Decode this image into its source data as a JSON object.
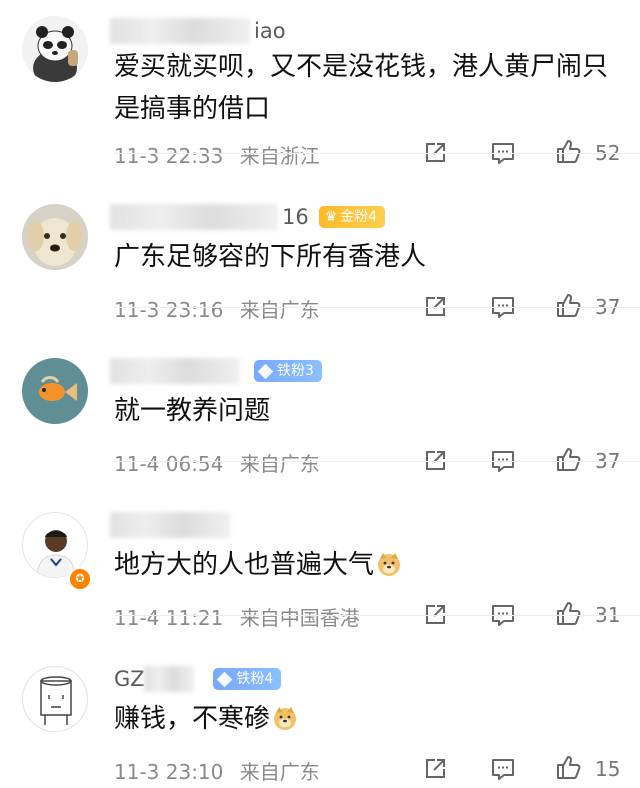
{
  "comments": [
    {
      "name_visible": "iao",
      "badge": null,
      "text": "爱买就买呗，又不是没花钱，港人黄尸闹只是搞事的借口",
      "time": "11-3 22:33",
      "location": "来自浙江",
      "likes": "52",
      "avatar": "panda-avatar"
    },
    {
      "name_visible": "16",
      "badge": {
        "type": "gold",
        "label": "金粉4"
      },
      "text": "广东足够容的下所有香港人",
      "time": "11-3 23:16",
      "location": "来自广东",
      "likes": "37",
      "avatar": "dog-avatar"
    },
    {
      "name_visible": "",
      "badge": {
        "type": "iron",
        "label": "铁粉3"
      },
      "text": "就一教养问题",
      "time": "11-4 06:54",
      "location": "来自广东",
      "likes": "37",
      "avatar": "goldfish-avatar"
    },
    {
      "name_visible": "",
      "badge": null,
      "text": "地方大的人也普遍大气",
      "emoji": "doge-emoji",
      "time": "11-4 11:21",
      "location": "来自中国香港",
      "likes": "31",
      "avatar": "footballer-avatar"
    },
    {
      "name_visible": "GZ",
      "badge": {
        "type": "iron",
        "label": "铁粉4"
      },
      "text": "赚钱，不寒碜",
      "emoji": "doge-emoji",
      "time": "11-3 23:10",
      "location": "来自广东",
      "likes": "15",
      "avatar": "sketch-avatar"
    }
  ],
  "icons": {
    "share": "share-icon",
    "reply": "comment-icon",
    "like": "thumbs-up-icon"
  },
  "colors": {
    "gold_badge": "#ffb929",
    "iron_badge": "#78a8ff",
    "meta_text": "#8a8a8a",
    "body_text": "#111111"
  }
}
